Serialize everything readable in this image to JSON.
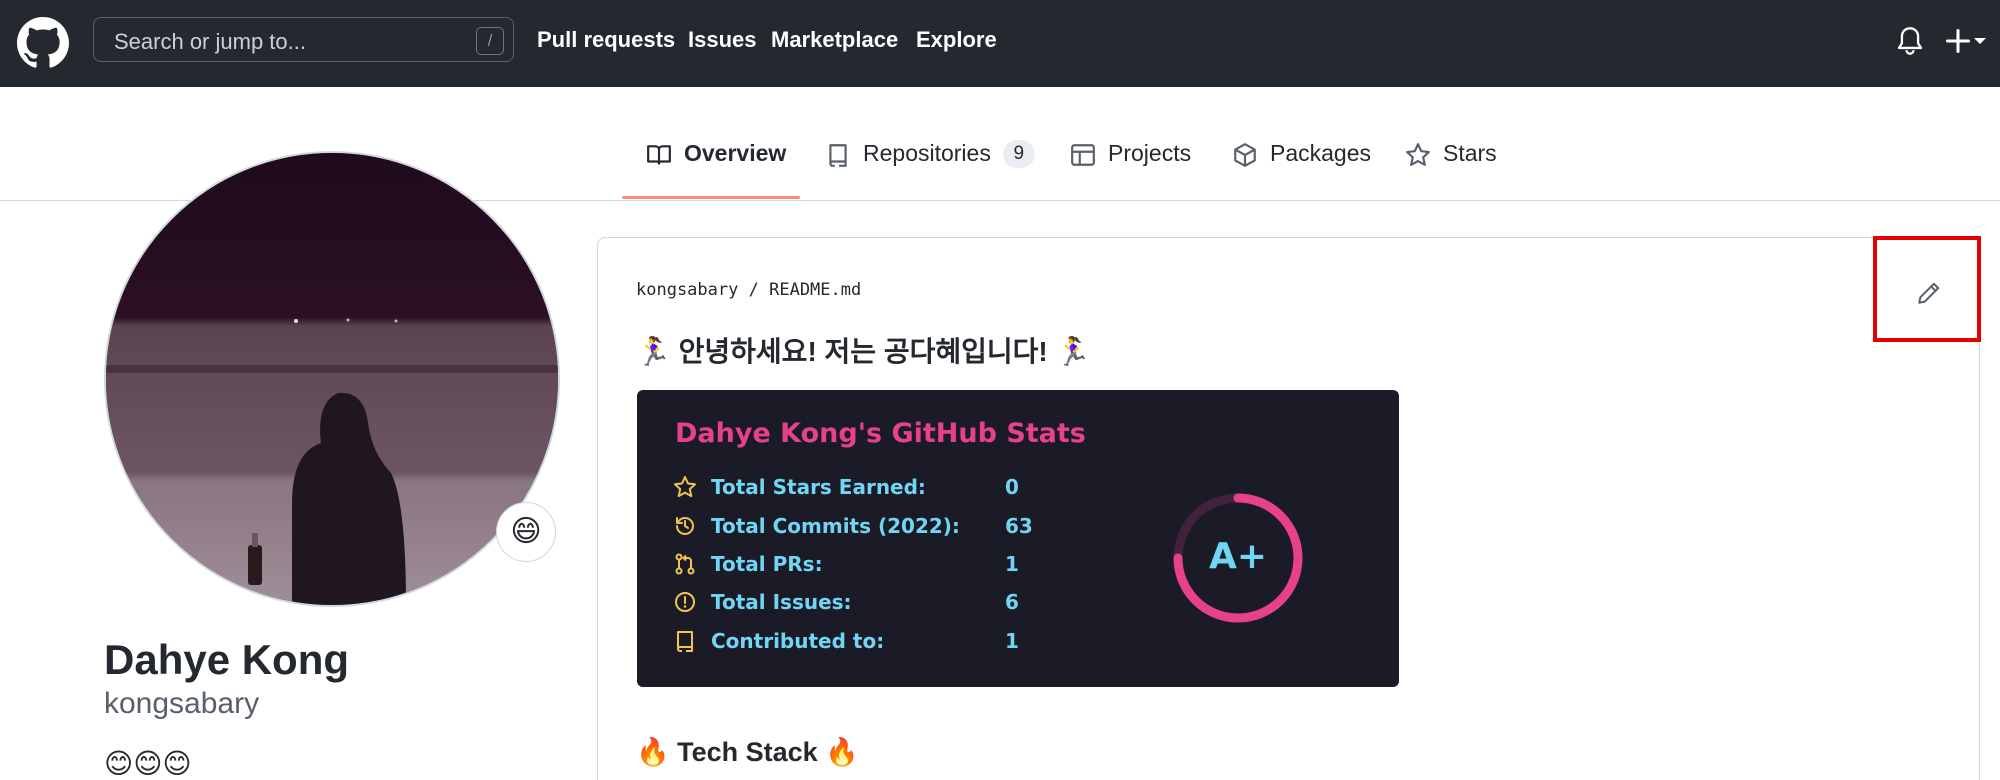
{
  "header": {
    "search_placeholder": "Search or jump to...",
    "search_shortcut": "/",
    "nav": [
      "Pull requests",
      "Issues",
      "Marketplace",
      "Explore"
    ]
  },
  "tabs": {
    "overview": "Overview",
    "repositories": "Repositories",
    "repositories_count": "9",
    "projects": "Projects",
    "packages": "Packages",
    "stars": "Stars"
  },
  "profile": {
    "status_emoji": "😄",
    "fullname": "Dahye Kong",
    "username": "kongsabary",
    "bio": "😊😊😊"
  },
  "readme": {
    "owner": "kongsabary",
    "separator": "/",
    "file": "README.md",
    "greeting": "🏃‍♀️ 안녕하세요! 저는 공다혜입니다! 🏃‍♀️",
    "tech_heading": "🔥 Tech Stack 🔥"
  },
  "stats_card": {
    "title": "Dahye Kong's GitHub Stats",
    "rows": [
      {
        "label": "Total Stars Earned:",
        "value": "0",
        "icon": "star-icon"
      },
      {
        "label": "Total Commits (2022):",
        "value": "63",
        "icon": "history-icon"
      },
      {
        "label": "Total PRs:",
        "value": "1",
        "icon": "pull-request-icon"
      },
      {
        "label": "Total Issues:",
        "value": "6",
        "icon": "issue-icon"
      },
      {
        "label": "Contributed to:",
        "value": "1",
        "icon": "repo-icon"
      }
    ],
    "rank": "A+",
    "rank_progress": 0.75,
    "colors": {
      "background": "#1a1b27",
      "title": "#e7418b",
      "text": "#70d6f3",
      "icon": "#f2c44c",
      "ring": "#e7418b"
    }
  },
  "colors": {
    "header_bg": "#24292f",
    "tab_underline": "#fd8c73",
    "highlight_box": "#e60000"
  }
}
